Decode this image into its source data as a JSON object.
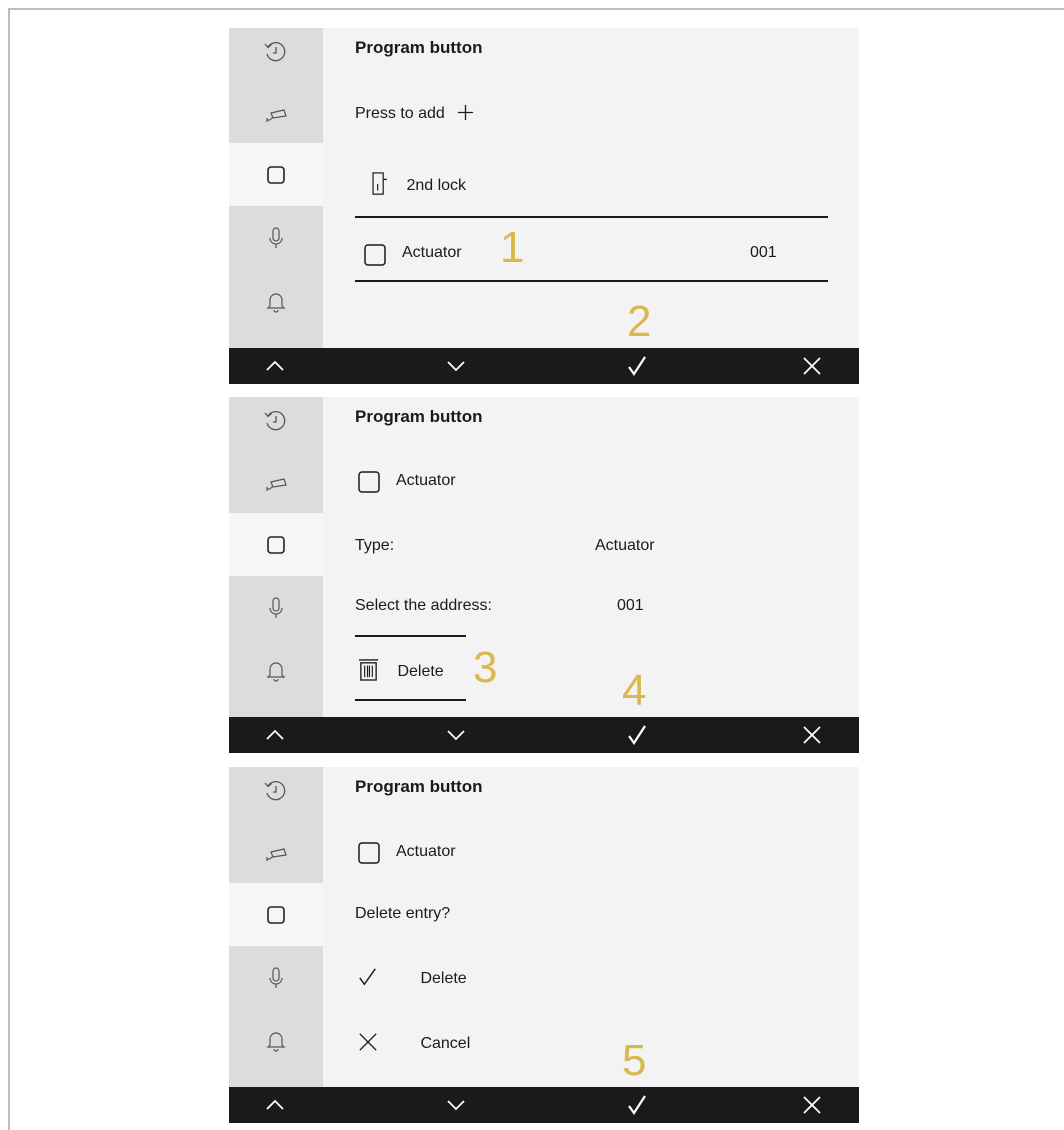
{
  "screens": [
    {
      "title": "Program button",
      "press_to_add": "Press to add",
      "lock_label": "2nd lock",
      "actuator_label": "Actuator",
      "actuator_address": "001",
      "step_a": "1",
      "step_b": "2"
    },
    {
      "title": "Program button",
      "actuator_label": "Actuator",
      "type_label": "Type:",
      "type_value": "Actuator",
      "address_label": "Select the address:",
      "address_value": "001",
      "delete_label": "Delete",
      "step_a": "3",
      "step_b": "4"
    },
    {
      "title": "Program button",
      "actuator_label": "Actuator",
      "question": "Delete entry?",
      "delete_label": "Delete",
      "cancel_label": "Cancel",
      "step_b": "5"
    }
  ],
  "sidebar_icons": [
    "history-icon",
    "camera-icon",
    "button-icon",
    "microphone-icon",
    "bell-icon"
  ],
  "bottombar_icons": [
    "chevron-up-icon",
    "chevron-down-icon",
    "check-icon",
    "close-icon"
  ],
  "colors": {
    "step_number": "#d9b94e",
    "bar": "#1a1a1a",
    "sidebar": "#dcdcdc",
    "screen": "#f3f3f3"
  }
}
